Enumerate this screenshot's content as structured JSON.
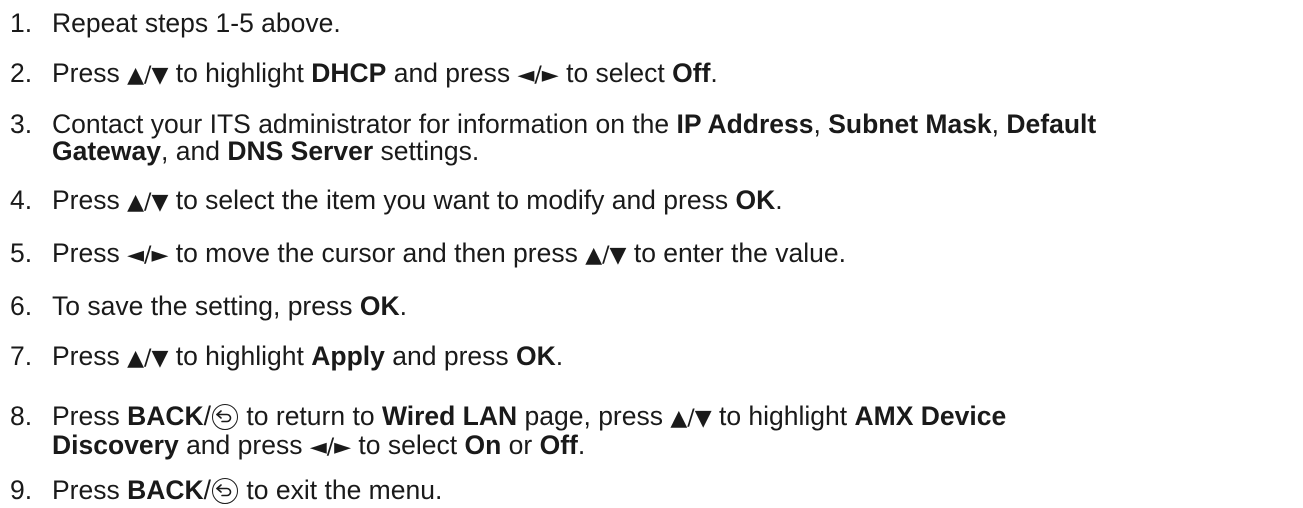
{
  "steps": [
    {
      "num": "1.",
      "lines": [
        [
          {
            "t": "Repeat steps 1-5 above."
          }
        ]
      ]
    },
    {
      "num": "2.",
      "lines": [
        [
          {
            "t": "Press "
          },
          {
            "g": "▲/▼",
            "icon": "up-down-arrow-icon"
          },
          {
            "t": " to highlight "
          },
          {
            "b": "DHCP"
          },
          {
            "t": " and press "
          },
          {
            "g": "◄/►",
            "icon": "left-right-arrow-icon"
          },
          {
            "t": " to select "
          },
          {
            "b": "Off"
          },
          {
            "t": "."
          }
        ]
      ]
    },
    {
      "num": "3.",
      "lines": [
        [
          {
            "t": "Contact your ITS administrator for information on the "
          },
          {
            "b": "IP Address"
          },
          {
            "t": ", "
          },
          {
            "b": "Subnet Mask"
          },
          {
            "t": ", "
          },
          {
            "b": "Default"
          }
        ],
        [
          {
            "b": "Gateway"
          },
          {
            "t": ", and "
          },
          {
            "b": "DNS Server"
          },
          {
            "t": " settings."
          }
        ]
      ]
    },
    {
      "num": "4.",
      "lines": [
        [
          {
            "t": "Press "
          },
          {
            "g": "▲/▼",
            "icon": "up-down-arrow-icon"
          },
          {
            "t": " to select the item you want to modify and press "
          },
          {
            "b": "OK"
          },
          {
            "t": "."
          }
        ]
      ]
    },
    {
      "num": "5.",
      "lines": [
        [
          {
            "t": "Press "
          },
          {
            "g": "◄/►",
            "icon": "left-right-arrow-icon"
          },
          {
            "t": " to move the cursor and then press "
          },
          {
            "g": "▲/▼",
            "icon": "up-down-arrow-icon"
          },
          {
            "t": " to enter the value."
          }
        ]
      ]
    },
    {
      "num": "6.",
      "lines": [
        [
          {
            "t": "To save the setting, press "
          },
          {
            "b": "OK"
          },
          {
            "t": "."
          }
        ]
      ]
    },
    {
      "num": "7.",
      "lines": [
        [
          {
            "t": "Press "
          },
          {
            "g": "▲/▼",
            "icon": "up-down-arrow-icon"
          },
          {
            "t": " to highlight "
          },
          {
            "b": "Apply"
          },
          {
            "t": " and press "
          },
          {
            "b": "OK"
          },
          {
            "t": "."
          }
        ]
      ]
    },
    {
      "num": "8.",
      "lines": [
        [
          {
            "t": "Press "
          },
          {
            "b": "BACK"
          },
          {
            "t": "/"
          },
          {
            "icon": "back-icon"
          },
          {
            "t": " to return to "
          },
          {
            "b": "Wired LAN"
          },
          {
            "t": " page, press "
          },
          {
            "g": "▲/▼",
            "icon": "up-down-arrow-icon"
          },
          {
            "t": " to highlight "
          },
          {
            "b": "AMX Device"
          }
        ],
        [
          {
            "b": "Discovery"
          },
          {
            "t": " and press "
          },
          {
            "g": "◄/►",
            "icon": "left-right-arrow-icon"
          },
          {
            "t": " to select "
          },
          {
            "b": "On"
          },
          {
            "t": " or "
          },
          {
            "b": "Off"
          },
          {
            "t": "."
          }
        ]
      ]
    },
    {
      "num": "9.",
      "lines": [
        [
          {
            "t": "Press "
          },
          {
            "b": "BACK"
          },
          {
            "t": "/"
          },
          {
            "icon": "back-icon"
          },
          {
            "t": " to exit the menu."
          }
        ]
      ]
    }
  ]
}
